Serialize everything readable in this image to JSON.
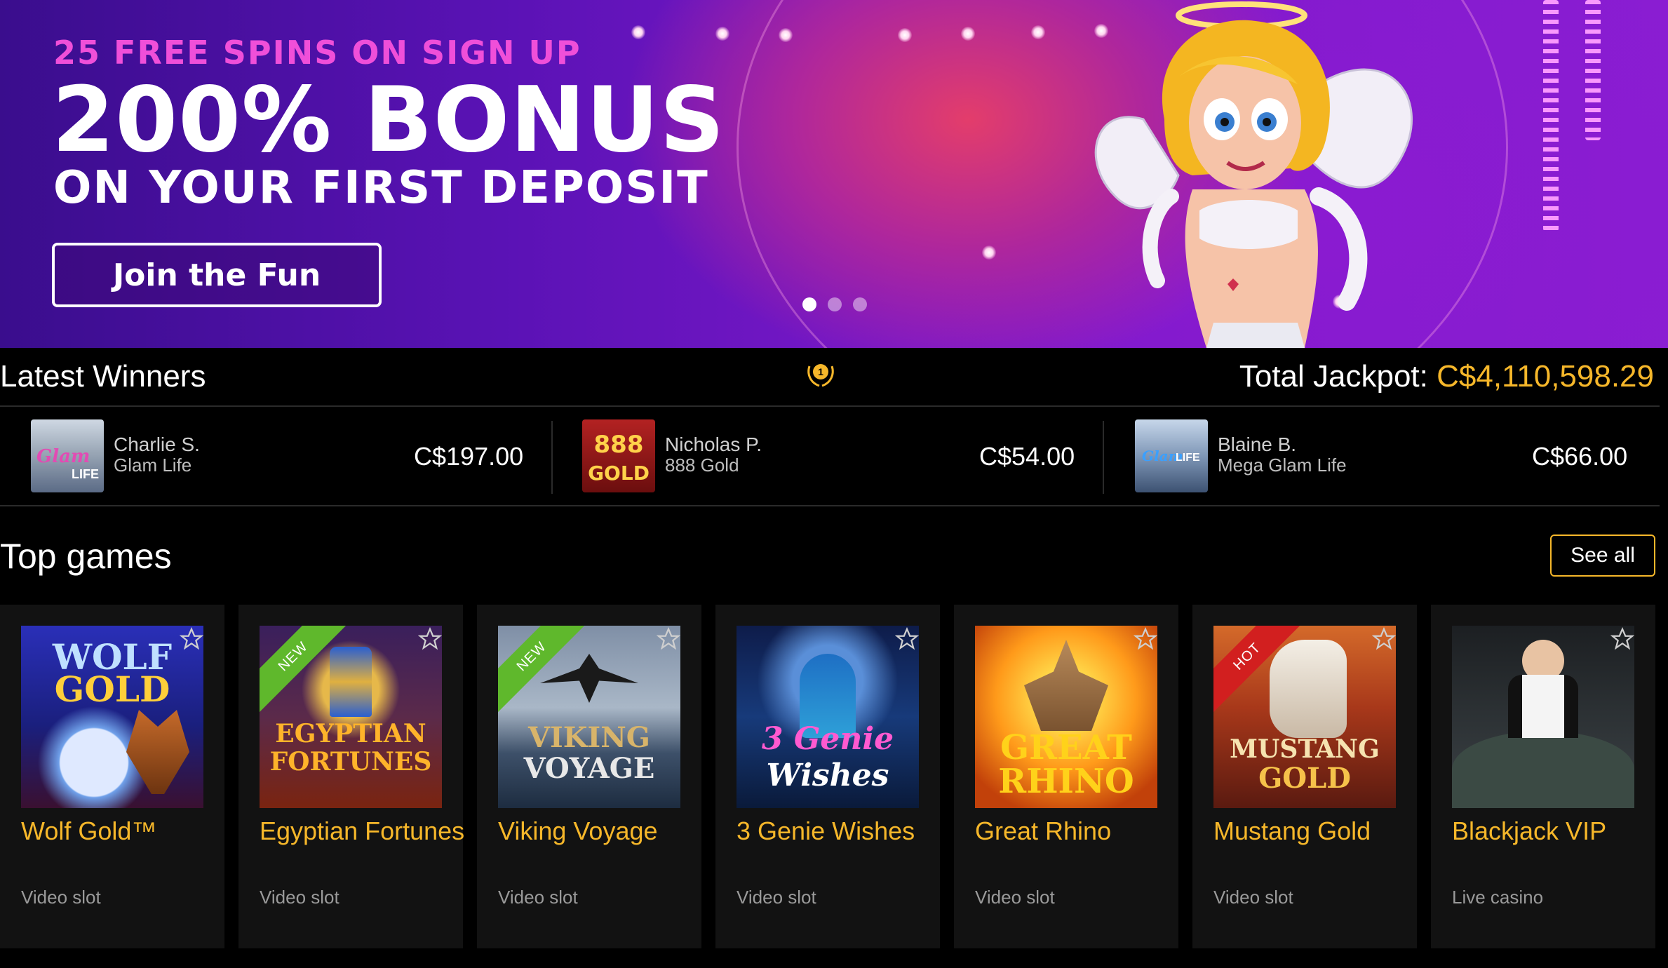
{
  "hero": {
    "promo_top": "25 FREE SPINS ON SIGN UP",
    "promo_big": "200% BONUS",
    "promo_sub": "ON YOUR FIRST DEPOSIT",
    "cta_label": "Join the Fun",
    "carousel": {
      "slides": 3,
      "active": 1
    }
  },
  "winners": {
    "title": "Latest Winners",
    "jackpot_label": "Total Jackpot:",
    "jackpot_amount": "C$4,110,598.29",
    "items": [
      {
        "name": "Charlie S.",
        "game": "Glam Life",
        "amount": "C$197.00",
        "thumb_text": "Glam LIFE"
      },
      {
        "name": "Nicholas P.",
        "game": "888 Gold",
        "amount": "C$54.00",
        "thumb_text": "888 GOLD"
      },
      {
        "name": "Blaine B.",
        "game": "Mega Glam Life",
        "amount": "C$66.00",
        "thumb_text": "Glam LIFE"
      }
    ]
  },
  "top_games": {
    "title": "Top games",
    "see_all_label": "See all",
    "games": [
      {
        "name": "Wolf Gold™",
        "type": "Video slot",
        "badge": "",
        "art_text_1": "WOLF",
        "art_text_2": "GOLD"
      },
      {
        "name": "Egyptian Fortunes",
        "type": "Video slot",
        "badge": "NEW",
        "art_text_1": "EGYPTIAN",
        "art_text_2": "FORTUNES"
      },
      {
        "name": "Viking Voyage",
        "type": "Video slot",
        "badge": "NEW",
        "art_text_1": "VIKING",
        "art_text_2": "VOYAGE"
      },
      {
        "name": "3 Genie Wishes",
        "type": "Video slot",
        "badge": "",
        "art_text_1": "3 Genie",
        "art_text_2": "Wishes"
      },
      {
        "name": "Great Rhino",
        "type": "Video slot",
        "badge": "",
        "art_text_1": "GREAT",
        "art_text_2": "RHINO"
      },
      {
        "name": "Mustang Gold",
        "type": "Video slot",
        "badge": "HOT",
        "art_text_1": "MUSTANG",
        "art_text_2": "GOLD"
      },
      {
        "name": "Blackjack VIP",
        "type": "Live casino",
        "badge": "",
        "art_text_1": "",
        "art_text_2": ""
      }
    ]
  },
  "colors": {
    "accent_gold": "#f6b72a",
    "hero_purple": "#6a14bd",
    "badge_new": "#5fb82c",
    "badge_hot": "#d21f1f"
  }
}
